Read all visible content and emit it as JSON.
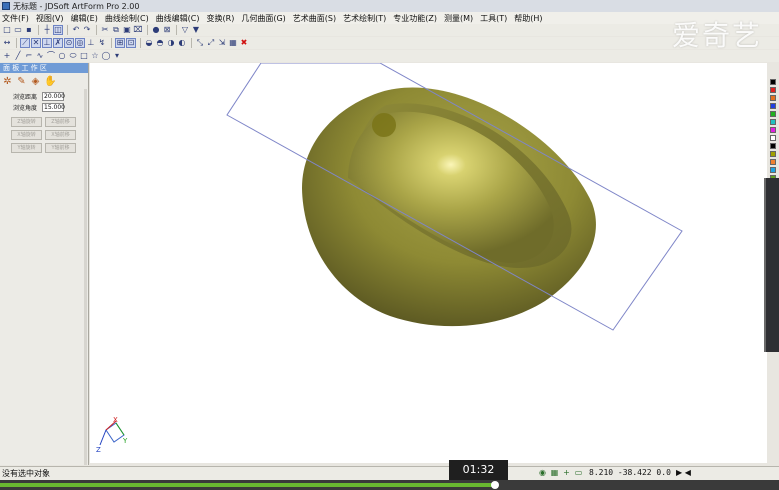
{
  "window": {
    "title": "无标题 - JDSoft ArtForm Pro 2.00"
  },
  "menu": [
    "文件(F)",
    "视图(V)",
    "编辑(E)",
    "曲线绘制(C)",
    "曲线编辑(C)",
    "变换(R)",
    "几何曲面(G)",
    "艺术曲面(S)",
    "艺术绘制(T)",
    "专业功能(Z)",
    "测量(M)",
    "工具(T)",
    "帮助(H)"
  ],
  "watermark": "爱奇艺",
  "panel": {
    "title": "面 板 工 作 区",
    "fields": [
      {
        "label": "浏览距离",
        "value": "20.000"
      },
      {
        "label": "浏览角度",
        "value": "15.000"
      }
    ],
    "buttons": [
      "Z轴旋转",
      "Z轴前移",
      "X轴旋转",
      "X轴前移",
      "Y轴旋转",
      "Y轴前移"
    ]
  },
  "axis": {
    "x": "X",
    "y": "Y",
    "z": "Z"
  },
  "status": {
    "message": "没有选中对象",
    "timestamp": "01:32",
    "coords": "8.210 -38.422 0.0"
  },
  "video": {
    "progress": 0.635
  },
  "colors": {
    "accent": "#6f9bd6",
    "palette": [
      "#000000",
      "#e02020",
      "#e07020",
      "#2040e0",
      "#20b020",
      "#20c0c0",
      "#e020e0",
      "#ffffff",
      "#000000",
      "#a0a000",
      "#f08030",
      "#20a0e0",
      "#60a020",
      "#806020"
    ]
  }
}
